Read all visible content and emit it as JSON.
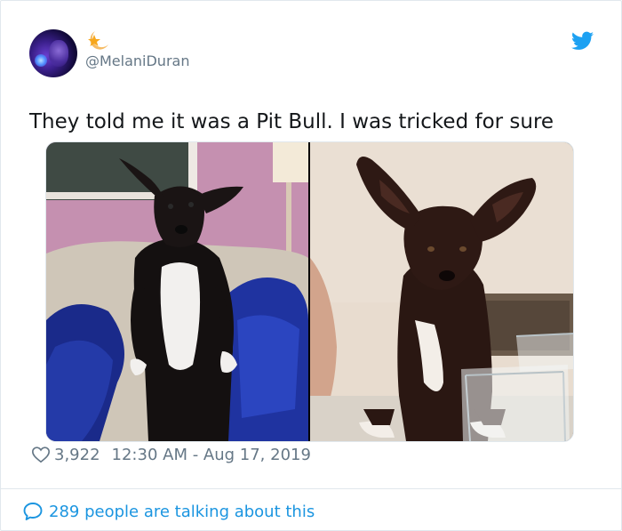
{
  "tweet": {
    "handle": "@MelaniDuran",
    "text": "They told me it was a Pit Bull. I was tricked for sure",
    "likes": "3,922",
    "timestamp": "12:30 AM - Aug 17, 2019",
    "talking_link": "289 people are talking about this"
  },
  "icons": {
    "brand": "twitter-bird-icon",
    "badge": "star-moon-icon",
    "like": "heart-icon",
    "reply": "speech-bubble-icon"
  },
  "colors": {
    "twitter_blue": "#1da1f2",
    "link_blue": "#1b95e0",
    "meta_gray": "#657786",
    "text": "#14171a",
    "border": "#e1e8ed"
  }
}
